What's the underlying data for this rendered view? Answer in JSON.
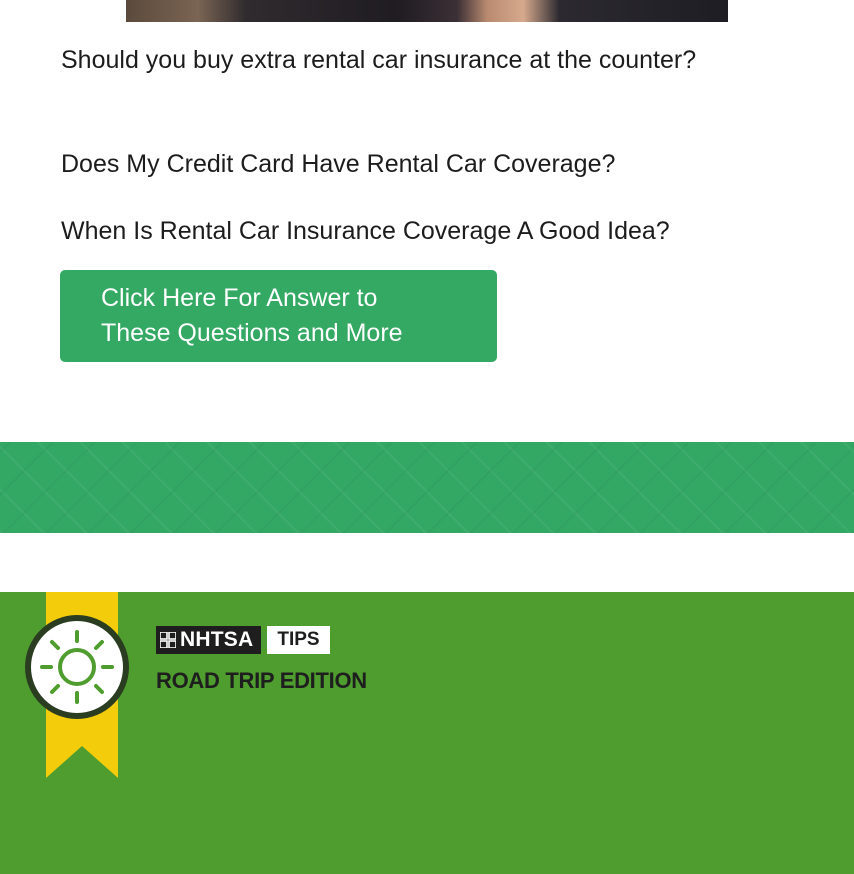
{
  "article": {
    "questions": [
      "Should you buy extra rental car insurance at the counter?",
      "Does My Credit Card Have Rental Car Coverage?",
      "When Is Rental Car Insurance Coverage A Good Idea?"
    ],
    "cta": {
      "line1": "Click Here For Answer to",
      "line2": "These Questions and More"
    }
  },
  "tips_banner": {
    "brand": "NHTSA",
    "badge_label": "TIPS",
    "edition": "ROAD TRIP EDITION",
    "icon": "sun-icon"
  },
  "colors": {
    "cta_green": "#33a964",
    "band_green": "#33a865",
    "panel_green": "#4e9d2e",
    "ribbon_yellow": "#f3cd0b",
    "dark": "#1e1e1e"
  }
}
